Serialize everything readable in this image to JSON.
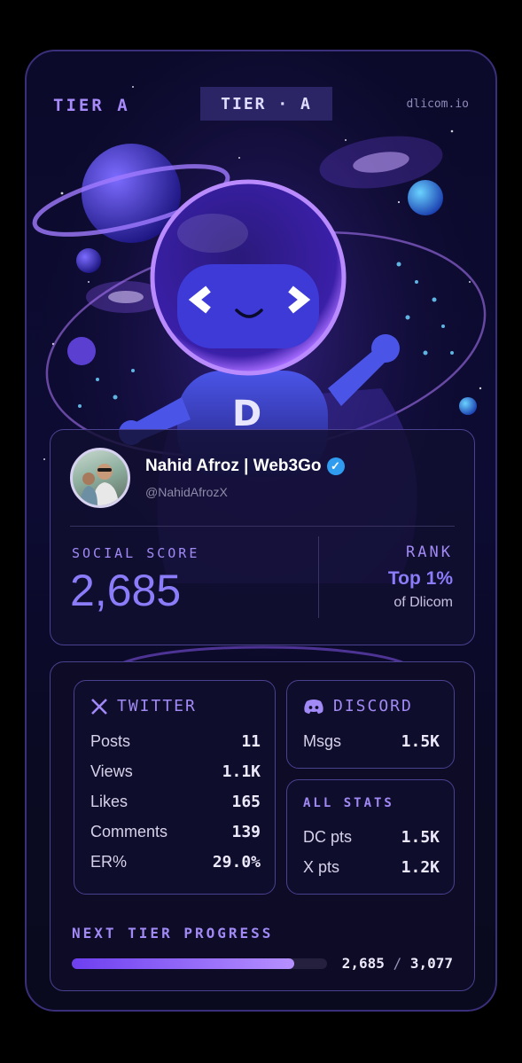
{
  "header": {
    "tier_label": "TIER A",
    "tier_badge": "TIER · A",
    "domain": "dlicom.io"
  },
  "profile": {
    "name": "Nahid Afroz | Web3Go",
    "handle": "@NahidAfrozX",
    "verified": true,
    "social_score_label": "SOCIAL SCORE",
    "social_score": "2,685",
    "rank_label": "RANK",
    "rank_value": "Top 1%",
    "rank_sub": "of Dlicom"
  },
  "twitter": {
    "title": "TWITTER",
    "icon": "x-logo-icon",
    "rows": [
      {
        "label": "Posts",
        "value": "11"
      },
      {
        "label": "Views",
        "value": "1.1K"
      },
      {
        "label": "Likes",
        "value": "165"
      },
      {
        "label": "Comments",
        "value": "139"
      },
      {
        "label": "ER%",
        "value": "29.0%"
      }
    ]
  },
  "discord": {
    "title": "DISCORD",
    "icon": "discord-logo-icon",
    "rows": [
      {
        "label": "Msgs",
        "value": "1.5K"
      }
    ]
  },
  "all_stats": {
    "title": "ALL STATS",
    "rows": [
      {
        "label": "DC pts",
        "value": "1.5K"
      },
      {
        "label": "X pts",
        "value": "1.2K"
      }
    ]
  },
  "progress": {
    "label": "NEXT TIER PROGRESS",
    "current": "2,685",
    "target": "3,077",
    "fraction": 0.873
  },
  "colors": {
    "accent": "#8b7cf9",
    "border": "#4a4190",
    "background": "#0b0a2a",
    "verified": "#2f9cf0"
  }
}
